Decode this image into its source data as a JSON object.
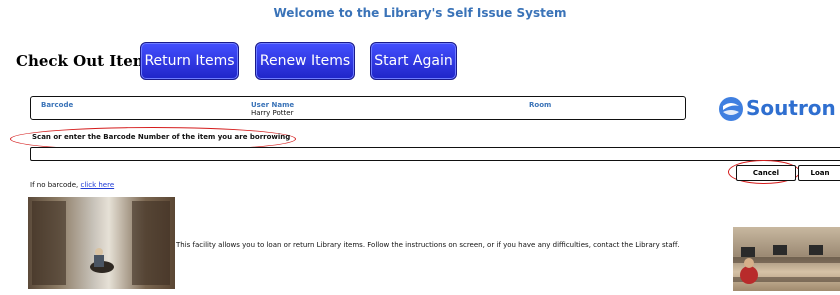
{
  "header": {
    "welcome": "Welcome to the Library's Self Issue System"
  },
  "nav": {
    "title": "Check Out Items",
    "buttons": [
      "Return Items",
      "Renew Items",
      "Start Again"
    ]
  },
  "info": {
    "barcode_label": "Barcode",
    "user_label": "User Name",
    "user_value": "Harry Potter",
    "room_label": "Room"
  },
  "logo": {
    "text": "Soutron",
    "color": "#2f6fd0"
  },
  "scan": {
    "label": "Scan or enter the Barcode Number of the item you are borrowing",
    "input_value": ""
  },
  "actions": {
    "cancel": "Cancel",
    "loan": "Loan"
  },
  "no_barcode": {
    "text": "If no barcode, ",
    "link": "click here"
  },
  "description": "This facility allows you to loan or return Library items. Follow the instructions on screen, or if you have any difficulties, contact the Library staff.",
  "colors": {
    "accent": "#3a73b8",
    "button": "#2a34e6",
    "highlight": "#d41c1c"
  }
}
